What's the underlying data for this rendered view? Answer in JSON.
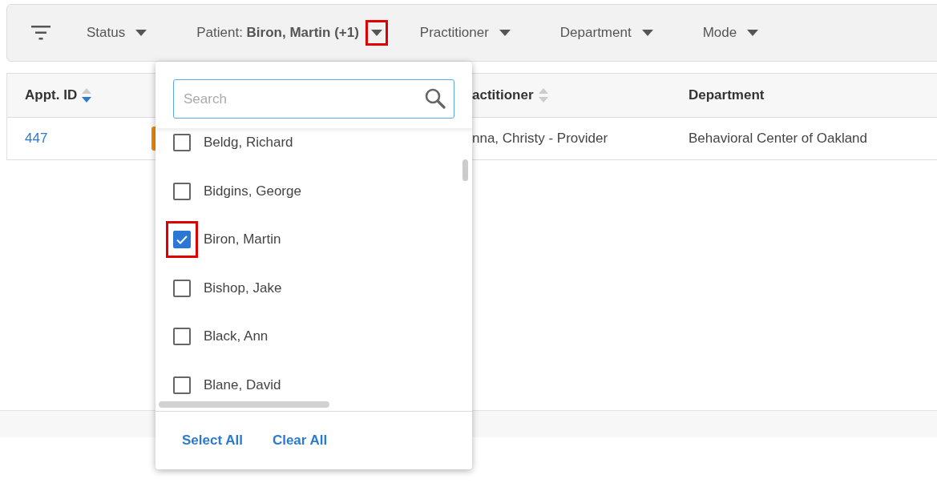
{
  "filter_bar": {
    "filters": [
      {
        "label": "Status",
        "highlighted": false
      },
      {
        "label": "Patient:",
        "value": "Biron, Martin (+1)",
        "highlighted": true
      },
      {
        "label": "Practitioner",
        "highlighted": false
      },
      {
        "label": "Department",
        "highlighted": false
      },
      {
        "label": "Mode",
        "highlighted": false
      }
    ]
  },
  "table": {
    "columns": [
      {
        "label": "Appt. ID",
        "sorted": true
      },
      {
        "label": "actitioner",
        "sorted": false
      },
      {
        "label": "Department"
      }
    ],
    "rows": [
      {
        "cells": [
          "447",
          "nna, Christy - Provider",
          "Behavioral Center of Oakland"
        ],
        "color": "#f08a00"
      }
    ]
  },
  "patient_dropdown": {
    "search": {
      "placeholder": "Search"
    },
    "items": [
      {
        "label": "Beldg, Richard",
        "checked": false,
        "highlighted": false
      },
      {
        "label": "Bidgins, George",
        "checked": false,
        "highlighted": false
      },
      {
        "label": "Biron, Martin",
        "checked": true,
        "highlighted": true
      },
      {
        "label": "Bishop, Jake",
        "checked": false,
        "highlighted": false
      },
      {
        "label": "Black, Ann",
        "checked": false,
        "highlighted": false
      },
      {
        "label": "Blane, David",
        "checked": false,
        "highlighted": false
      }
    ],
    "actions": [
      "Select All",
      "Clear All"
    ]
  }
}
